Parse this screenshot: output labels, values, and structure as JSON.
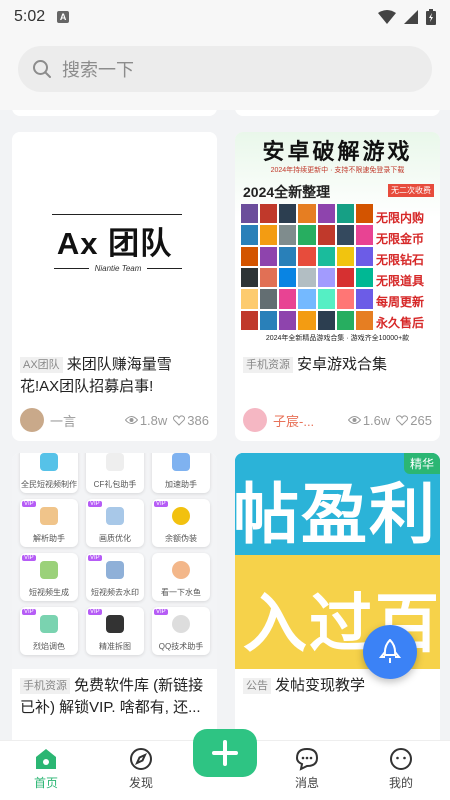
{
  "status_bar": {
    "time": "5:02"
  },
  "search": {
    "placeholder": "搜索一下"
  },
  "cards": [
    {
      "tag": "AX团队",
      "title": "来团队赚海量雪花!AX团队招募启事!",
      "author": "一言",
      "views": "1.8w",
      "likes": "386",
      "image_title": "Ax 团队",
      "image_subtitle": "Niantie Team"
    },
    {
      "tag": "手机资源",
      "title": "安卓游戏合集",
      "author": "子宸-...",
      "views": "1.6w",
      "likes": "265",
      "poster": {
        "heading": "安卓破解游戏",
        "line1": "2024年持续更新中 · 支持不限速免登录下载",
        "line2": "2024全新整理",
        "no_second_charge": "无二次收费",
        "features": [
          "无限内购",
          "无限金币",
          "无限钻石",
          "无限道具",
          "每周更新",
          "永久售后"
        ],
        "footer": "2024年全新精品游戏合集 · 游戏齐全10000+款"
      }
    },
    {
      "tag": "手机资源",
      "title": "免费软件库 (新链接已补) 解锁VIP. 啥都有, 还...",
      "author": "",
      "apps": [
        "全民短视频制作",
        "CF礼包助手",
        "加速助手",
        "解析助手",
        "画质优化",
        "余额伪装",
        "短视频生成",
        "短视频去水印",
        "看一下水鱼",
        "烈焰调色",
        "精准拆图",
        "QQ技术助手"
      ]
    },
    {
      "tag": "公告",
      "title": "发帖变现教学",
      "badge": "精华",
      "poster_text": [
        "帖盈利",
        "入过百"
      ]
    }
  ],
  "tabbar": [
    {
      "label": "首页",
      "active": true
    },
    {
      "label": "发现",
      "active": false
    },
    {
      "label": "消息",
      "active": false
    },
    {
      "label": "我的",
      "active": false
    }
  ],
  "colors": {
    "accent": "#2bb673",
    "fab_blue": "#3b82f6",
    "poster_yellow": "#f6d24a",
    "poster_teal": "#2bb3d8"
  }
}
